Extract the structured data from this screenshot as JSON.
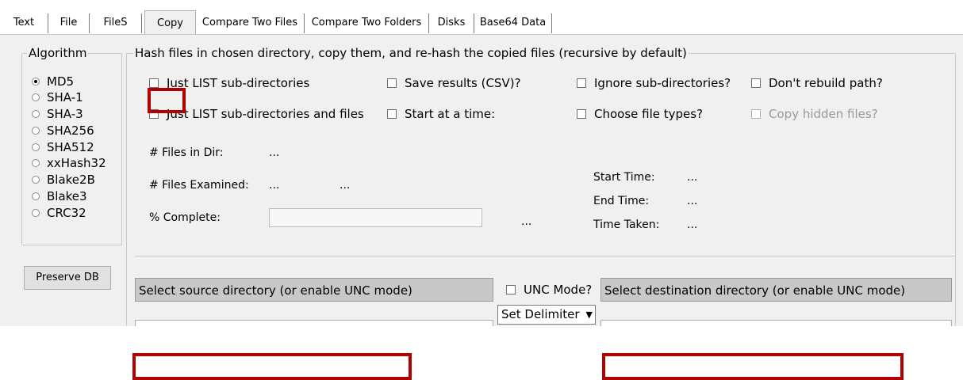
{
  "tabs": [
    {
      "label": "Text",
      "active": false
    },
    {
      "label": "File",
      "active": false
    },
    {
      "label": "FileS",
      "active": false
    },
    {
      "label": "Copy",
      "active": true
    },
    {
      "label": "Compare Two Files",
      "active": false
    },
    {
      "label": "Compare Two Folders",
      "active": false
    },
    {
      "label": "Disks",
      "active": false
    },
    {
      "label": "Base64 Data",
      "active": false
    }
  ],
  "algorithm": {
    "title": "Algorithm",
    "selected": "MD5",
    "options": [
      "MD5",
      "SHA-1",
      "SHA-3",
      "SHA256",
      "SHA512",
      "xxHash32",
      "Blake2B",
      "Blake3",
      "CRC32"
    ]
  },
  "preserve_db_label": "Preserve DB",
  "copy_group": {
    "title": "Hash files in chosen directory, copy them, and re-hash the copied files (recursive by default)",
    "checkboxes": {
      "just_list_subdirs": "Just LIST sub-directories",
      "just_list_subdirs_files": "Just LIST sub-directories and files",
      "save_results": "Save results (CSV)?",
      "start_at_time": "Start at a time:",
      "ignore_subdirs": "Ignore sub-directories?",
      "choose_file_types": "Choose file types?",
      "dont_rebuild_path": "Don't rebuild path?",
      "copy_hidden_files": "Copy hidden files?"
    },
    "stats": {
      "files_in_dir_label": "# Files in Dir:",
      "files_in_dir_value": "...",
      "files_examined_label": "# Files Examined:",
      "files_examined_value1": "...",
      "files_examined_value2": "...",
      "percent_complete_label": "% Complete:",
      "percent_complete_value": "...",
      "progress": 0,
      "start_time_label": "Start Time:",
      "start_time_value": "...",
      "end_time_label": "End Time:",
      "end_time_value": "...",
      "time_taken_label": "Time Taken:",
      "time_taken_value": "..."
    }
  },
  "source_dir_placeholder": "Select source directory (or enable UNC mode)",
  "dest_dir_placeholder": "Select destination directory (or enable UNC mode)",
  "unc_mode_label": "UNC Mode?",
  "delimiter_select": "Set Delimiter",
  "highlight_color": "#b00000"
}
